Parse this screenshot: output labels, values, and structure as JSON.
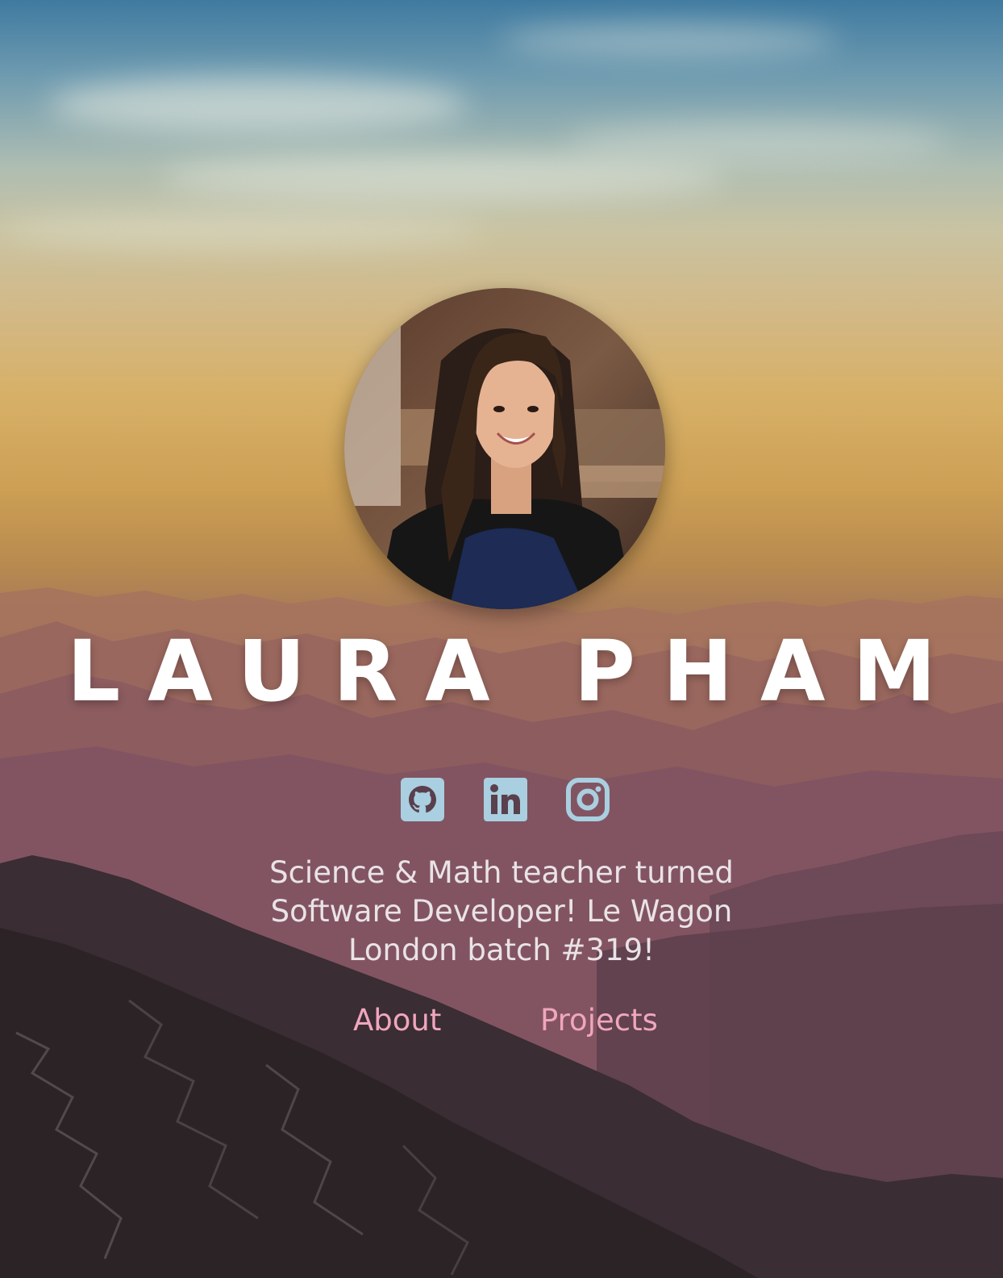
{
  "profile": {
    "name": "LAURA PHAM",
    "bio": "Science & Math teacher turned Software Developer! Le Wagon London batch #319!"
  },
  "social_links": [
    {
      "icon": "github-icon"
    },
    {
      "icon": "linkedin-icon"
    },
    {
      "icon": "instagram-icon"
    }
  ],
  "nav": {
    "about_label": "About",
    "projects_label": "Projects"
  },
  "colors": {
    "icon_color": "#a9cfe0",
    "link_color": "#f0a6bd",
    "name_color": "#ffffff",
    "bio_color": "#e9e3e6"
  }
}
